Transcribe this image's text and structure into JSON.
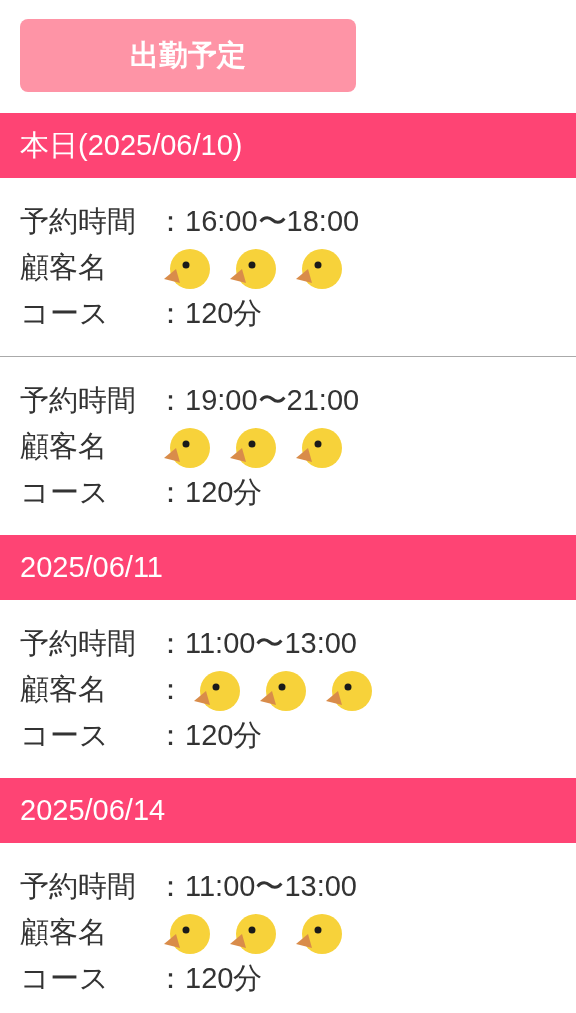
{
  "button": {
    "label": "出勤予定"
  },
  "days": [
    {
      "date": "本日(2025/06/10)",
      "bookings": [
        {
          "time_label": "予約時間",
          "time": "：16:00〜18:00",
          "customer_label": "顧客名",
          "course_label": "コース",
          "course": "：120分"
        },
        {
          "time_label": "予約時間",
          "time": "：19:00〜21:00",
          "customer_label": "顧客名",
          "course_label": "コース",
          "course": "：120分"
        }
      ]
    },
    {
      "date": "2025/06/11",
      "bookings": [
        {
          "time_label": "予約時間",
          "time": "：11:00〜13:00",
          "customer_label": "顧客名",
          "customer_value": "：",
          "course_label": "コース",
          "course": "：120分"
        }
      ]
    },
    {
      "date": "2025/06/14",
      "bookings": [
        {
          "time_label": "予約時間",
          "time": "：11:00〜13:00",
          "customer_label": "顧客名",
          "course_label": "コース",
          "course": "：120分"
        }
      ]
    }
  ]
}
